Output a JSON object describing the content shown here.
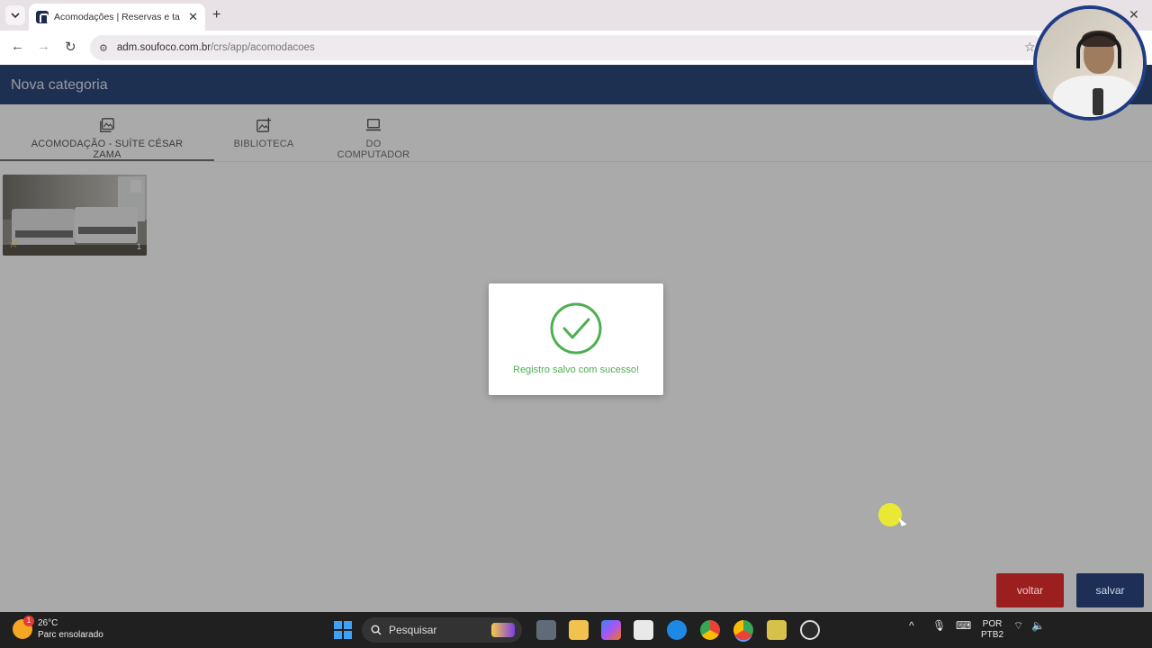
{
  "browser": {
    "tab_title": "Acomodações | Reservas e tarifas",
    "url_host": "adm.soufoco.com.br",
    "url_path": "/crs/app/acomodacoes"
  },
  "app": {
    "title": "Nova categoria"
  },
  "tabs": [
    {
      "label": "ACOMODAÇÃO - SUÍTE CÉSAR ZAMA",
      "icon": "image-gallery-icon",
      "active": true
    },
    {
      "label": "BIBLIOTECA",
      "icon": "image-add-icon",
      "active": false
    },
    {
      "label": "DO COMPUTADOR",
      "icon": "laptop-icon",
      "active": false
    }
  ],
  "gallery": {
    "items": [
      {
        "order": "1",
        "favorite": true
      }
    ]
  },
  "modal": {
    "message": "Registro salvo com sucesso!",
    "accent": "#4caf50"
  },
  "buttons": {
    "voltar": "voltar",
    "salvar": "salvar"
  },
  "taskbar": {
    "weather_temp": "26°C",
    "weather_desc": "Parc ensolarado",
    "weather_badge": "1",
    "search_label": "Pesquisar",
    "lang_line1": "POR",
    "lang_line2": "PTB2"
  },
  "colors": {
    "header": "#2b4574",
    "voltar_button": "#9c1f1f",
    "salvar_button": "#1d2f57"
  }
}
